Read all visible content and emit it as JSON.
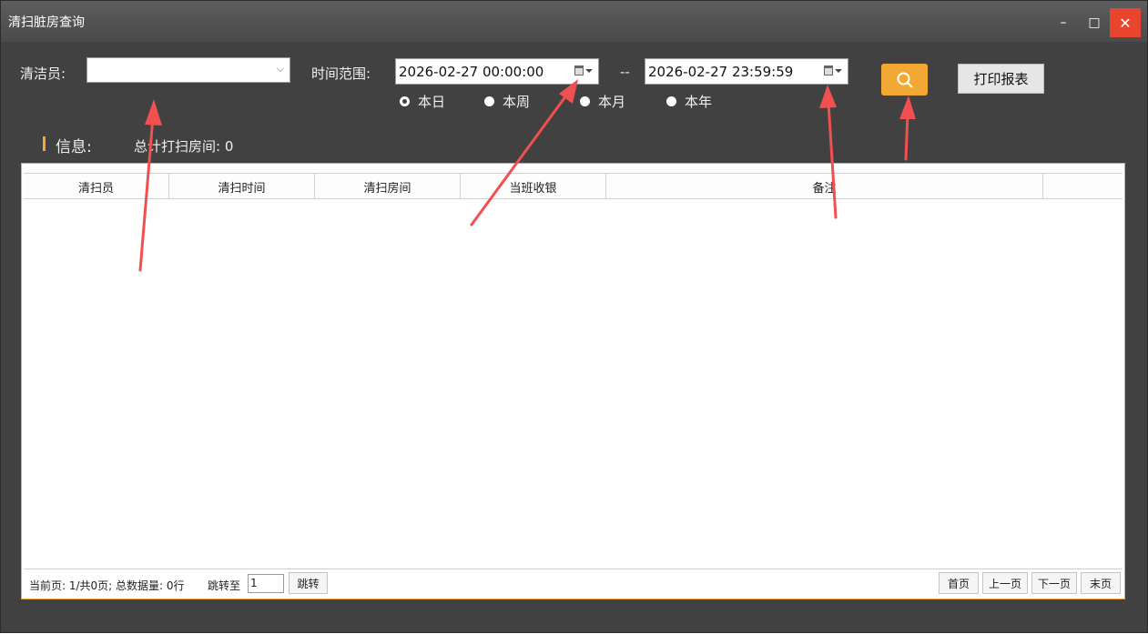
{
  "window": {
    "title": "清扫脏房查询",
    "controls": {
      "minimize": "–",
      "maximize": "□",
      "close": "✕"
    }
  },
  "filters": {
    "cleaner_label": "清洁员:",
    "cleaner_value": "",
    "time_range_label": "时间范围:",
    "start_time": "2026-02-27 00:00:00",
    "separator": "--",
    "end_time": "2026-02-27 23:59:59",
    "periods": [
      {
        "label": "本日",
        "selected": true
      },
      {
        "label": "本周",
        "selected": false
      },
      {
        "label": "本月",
        "selected": false
      },
      {
        "label": "本年",
        "selected": false
      }
    ],
    "search_icon": "search-icon",
    "print_label": "打印报表"
  },
  "info": {
    "label": "信息:",
    "total_label": "总计打扫房间: 0"
  },
  "table": {
    "columns": [
      "清扫员",
      "清扫时间",
      "清扫房间",
      "当班收银",
      "备注",
      ""
    ],
    "rows": []
  },
  "pager": {
    "info": "当前页: 1/共0页; 总数据量: 0行",
    "jump_label": "跳转至",
    "jump_value": "1",
    "jump_button": "跳转",
    "first": "首页",
    "prev": "上一页",
    "next": "下一页",
    "last": "末页"
  },
  "colors": {
    "accent": "#f3a833",
    "background": "#414141",
    "close": "#e8452f",
    "annotation_arrow": "#f05050"
  }
}
